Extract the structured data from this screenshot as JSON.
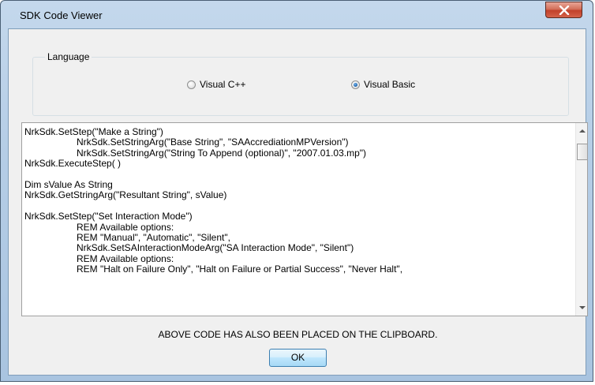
{
  "window": {
    "title": "SDK Code Viewer"
  },
  "language_group": {
    "legend": "Language",
    "options": [
      {
        "label": "Visual C++",
        "selected": false
      },
      {
        "label": "Visual Basic",
        "selected": true
      }
    ]
  },
  "code_lines": [
    {
      "text": "NrkSdk.SetStep(\"Make a String\")",
      "indent": false
    },
    {
      "text": "NrkSdk.SetStringArg(\"Base String\", \"SAAccrediationMPVersion\")",
      "indent": true
    },
    {
      "text": "NrkSdk.SetStringArg(\"String To Append (optional)\", \"2007.01.03.mp\")",
      "indent": true
    },
    {
      "text": "NrkSdk.ExecuteStep( )",
      "indent": false
    },
    {
      "text": "",
      "indent": false
    },
    {
      "text": "Dim sValue As String",
      "indent": false
    },
    {
      "text": "NrkSdk.GetStringArg(\"Resultant String\", sValue)",
      "indent": false
    },
    {
      "text": "",
      "indent": false
    },
    {
      "text": "NrkSdk.SetStep(\"Set Interaction Mode\")",
      "indent": false
    },
    {
      "text": "REM Available options:",
      "indent": true
    },
    {
      "text": "REM \"Manual\", \"Automatic\", \"Silent\",",
      "indent": true
    },
    {
      "text": "NrkSdk.SetSAInteractionModeArg(\"SA Interaction Mode\", \"Silent\")",
      "indent": true
    },
    {
      "text": "REM Available options:",
      "indent": true
    },
    {
      "text": "REM \"Halt on Failure Only\", \"Halt on Failure or Partial Success\", \"Never Halt\",",
      "indent": true
    }
  ],
  "notice": "ABOVE CODE HAS ALSO BEEN PLACED ON THE CLIPBOARD.",
  "buttons": {
    "ok": "OK"
  },
  "icons": {
    "close": "close-icon"
  },
  "colors": {
    "close_button": "#c2412a",
    "ok_border": "#3c7fb1"
  }
}
